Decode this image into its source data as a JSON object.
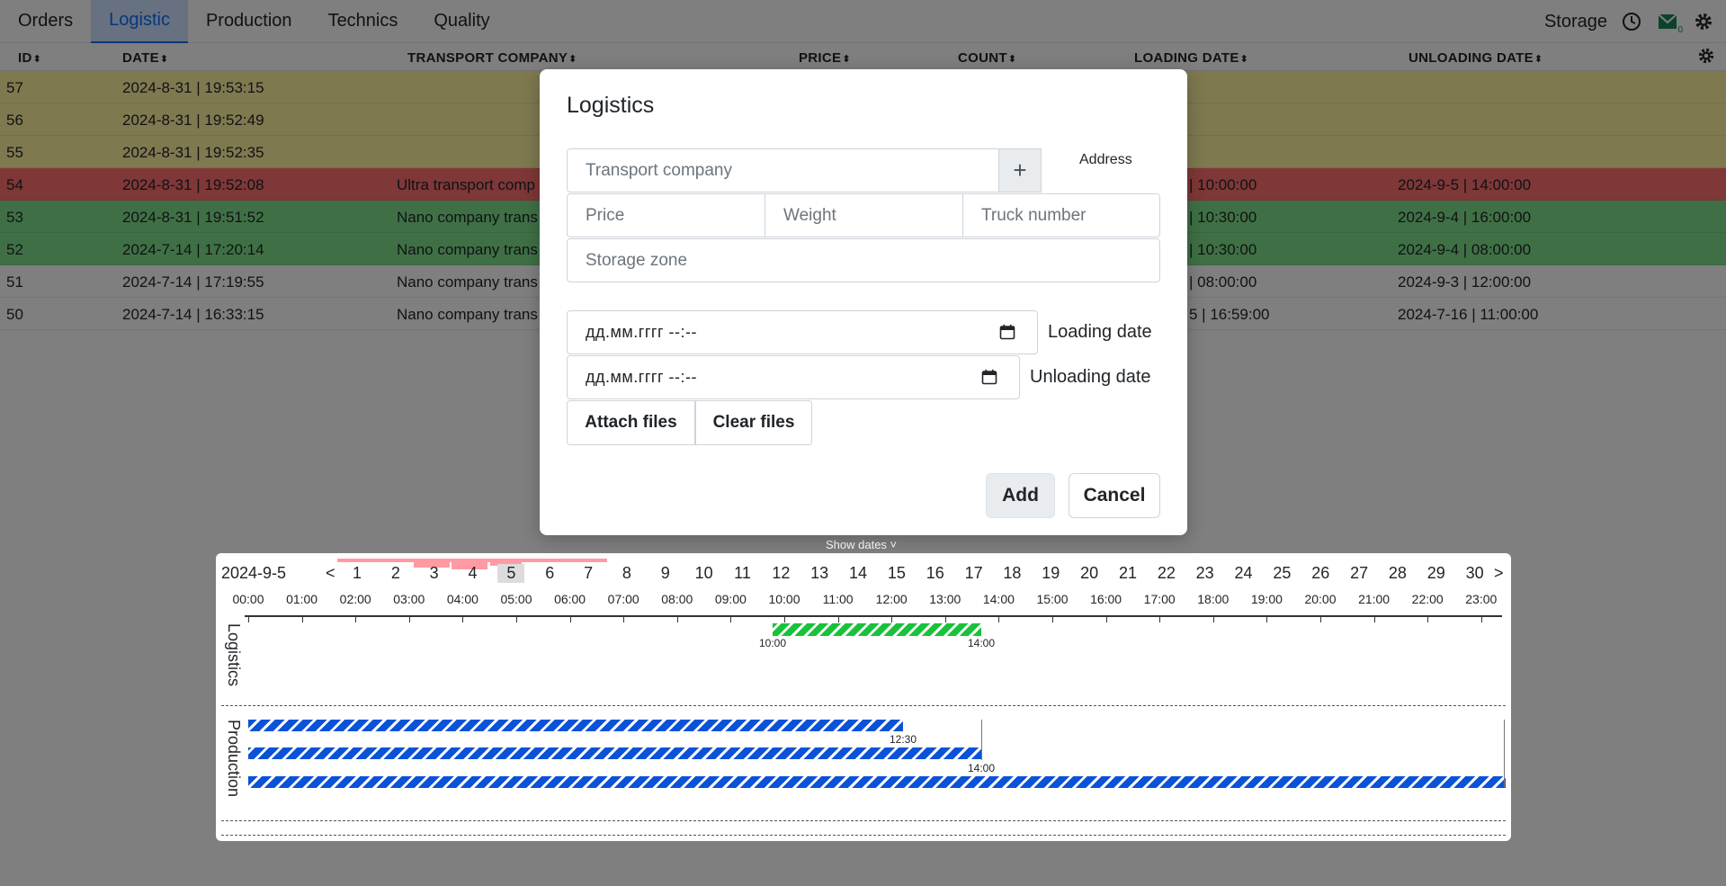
{
  "nav": {
    "tabs": [
      "Orders",
      "Logistic",
      "Production",
      "Technics",
      "Quality"
    ],
    "active_tab": "Logistic",
    "storage_label": "Storage",
    "mail_count": "0"
  },
  "table": {
    "headers": {
      "id": "ID",
      "date": "DATE",
      "transport_company": "TRANSPORT COMPANY",
      "price": "PRICE",
      "count": "COUNT",
      "loading_date": "LOADING DATE",
      "unloading_date": "UNLOADING DATE"
    },
    "sort_glyph": "⬍",
    "rows": [
      {
        "id": "57",
        "date": "2024-8-31 | 19:53:15",
        "tc": "",
        "load": "",
        "unload": "",
        "status": "yellow"
      },
      {
        "id": "56",
        "date": "2024-8-31 | 19:52:49",
        "tc": "",
        "load": "",
        "unload": "",
        "status": "yellow"
      },
      {
        "id": "55",
        "date": "2024-8-31 | 19:52:35",
        "tc": "",
        "load": "",
        "unload": "",
        "status": "yellow"
      },
      {
        "id": "54",
        "date": "2024-8-31 | 19:52:08",
        "tc": "Ultra transport comp",
        "load": "| 10:00:00",
        "unload": "2024-9-5 | 14:00:00",
        "status": "red"
      },
      {
        "id": "53",
        "date": "2024-8-31 | 19:51:52",
        "tc": "Nano company trans",
        "load": "| 10:30:00",
        "unload": "2024-9-4 | 16:00:00",
        "status": "green"
      },
      {
        "id": "52",
        "date": "2024-7-14 | 17:20:14",
        "tc": "Nano company trans",
        "load": "| 10:30:00",
        "unload": "2024-9-4 | 08:00:00",
        "status": "green"
      },
      {
        "id": "51",
        "date": "2024-7-14 | 17:19:55",
        "tc": "Nano company trans",
        "load": "| 08:00:00",
        "unload": "2024-9-3 | 12:00:00",
        "status": "white"
      },
      {
        "id": "50",
        "date": "2024-7-14 | 16:33:15",
        "tc": "Nano company trans",
        "load": "5 | 16:59:00",
        "unload": "2024-7-16 | 11:00:00",
        "status": "white"
      }
    ]
  },
  "modal": {
    "title": "Logistics",
    "transport_placeholder": "Transport company",
    "plus_label": "+",
    "address_label": "Address",
    "price_placeholder": "Price",
    "weight_placeholder": "Weight",
    "truck_placeholder": "Truck number",
    "storage_placeholder": "Storage zone",
    "date_placeholder": "дд.мм.гггг --:--",
    "loading_label": "Loading date",
    "unloading_label": "Unloading date",
    "attach_label": "Attach files",
    "clear_label": "Clear files",
    "add_label": "Add",
    "cancel_label": "Cancel"
  },
  "calendar": {
    "show_dates": "Show dates ˅",
    "current_date": "2024-9-5",
    "prev": "<",
    "next": ">",
    "selected_day": "5",
    "days": [
      "1",
      "2",
      "3",
      "4",
      "5",
      "6",
      "7",
      "8",
      "9",
      "10",
      "11",
      "12",
      "13",
      "14",
      "15",
      "16",
      "17",
      "18",
      "19",
      "20",
      "21",
      "22",
      "23",
      "24",
      "25",
      "26",
      "27",
      "28",
      "29",
      "30"
    ],
    "hours": [
      "00:00",
      "01:00",
      "02:00",
      "03:00",
      "04:00",
      "05:00",
      "06:00",
      "07:00",
      "08:00",
      "09:00",
      "10:00",
      "11:00",
      "12:00",
      "13:00",
      "14:00",
      "15:00",
      "16:00",
      "17:00",
      "18:00",
      "19:00",
      "20:00",
      "21:00",
      "22:00",
      "23:00"
    ],
    "lanes": {
      "logistics": "Logistics",
      "production": "Production"
    },
    "logistics_bar": {
      "start": "10:00",
      "end": "14:00",
      "color": "#18c23a"
    },
    "production_bars": [
      {
        "end_label": "12:30",
        "color": "#0a52d8"
      },
      {
        "end_label": "14:00",
        "color": "#0a52d8"
      },
      {
        "end_label": "",
        "color": "#0a52d8"
      }
    ]
  }
}
